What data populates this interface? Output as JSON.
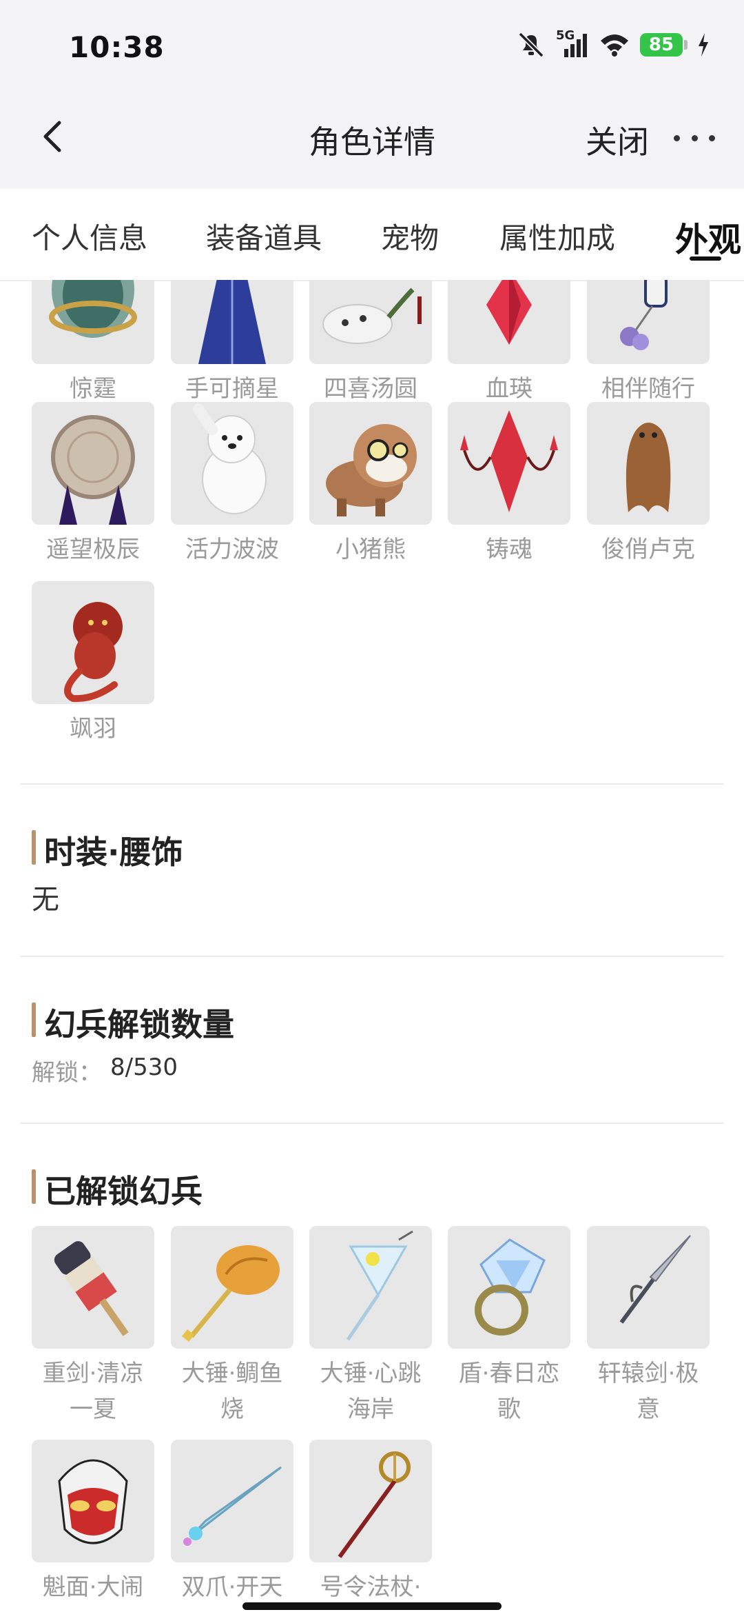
{
  "status": {
    "time": "10:38",
    "network": "5G",
    "battery": "85"
  },
  "nav": {
    "title": "角色详情",
    "close_label": "关闭"
  },
  "tabs": [
    "个人信息",
    "装备道具",
    "宠物",
    "属性加成",
    "外观"
  ],
  "pets_grid": {
    "row1": [
      "惊霆",
      "手可摘星",
      "四喜汤圆",
      "血瑛",
      "相伴随行"
    ],
    "row2": [
      "遥望极辰",
      "活力波波",
      "小猪熊",
      "铸魂",
      "俊俏卢克"
    ],
    "row3": [
      "飒羽"
    ]
  },
  "waist_section": {
    "title": "时装·腰饰",
    "value": "无"
  },
  "unlock_count_section": {
    "title": "幻兵解锁数量",
    "label": "解锁：",
    "value": "8/530"
  },
  "unlocked_section": {
    "title": "已解锁幻兵",
    "row1": [
      {
        "line1": "重剑·清凉",
        "line2": "一夏"
      },
      {
        "line1": "大锤·鲷鱼",
        "line2": "烧"
      },
      {
        "line1": "大锤·心跳",
        "line2": "海岸"
      },
      {
        "line1": "盾·春日恋",
        "line2": "歌"
      },
      {
        "line1": "轩辕剑·极",
        "line2": "意"
      }
    ],
    "row2": [
      {
        "line1": "魁面·大闹"
      },
      {
        "line1": "双爪·开天"
      },
      {
        "line1": "号令法杖·"
      }
    ]
  },
  "colors": {
    "accent_bar": "#b9926b",
    "battery_green": "#35c44a",
    "tile_bg": "#e7e7e7"
  },
  "icons": [
    "chevron-left-icon",
    "more-icon",
    "bell-mute-icon",
    "signal-icon",
    "wifi-icon",
    "charging-icon"
  ]
}
